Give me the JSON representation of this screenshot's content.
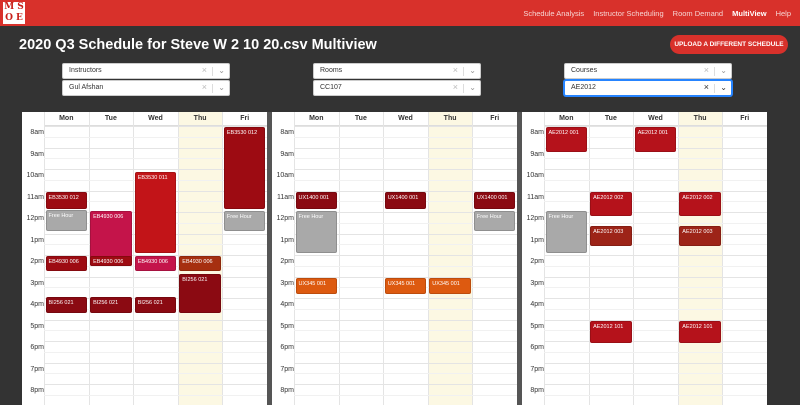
{
  "nav": {
    "schedule_analysis": "Schedule Analysis",
    "instructor_scheduling": "Instructor Scheduling",
    "room_demand": "Room Demand",
    "multiview": "MultiView",
    "help": "Help"
  },
  "logo": {
    "l1": "M S",
    "l2": "O E"
  },
  "page": {
    "title": "2020 Q3 Schedule for Steve W 2 10 20.csv Multiview",
    "upload_label": "UPLOAD A DIFFERENT SCHEDULE"
  },
  "selects": {
    "p1": {
      "type": "Instructors",
      "value": "Gul Afshan"
    },
    "p2": {
      "type": "Rooms",
      "value": "CC107"
    },
    "p3": {
      "type": "Courses",
      "value": "AE2012"
    }
  },
  "days": [
    "Mon",
    "Tue",
    "Wed",
    "Thu",
    "Fri"
  ],
  "times": [
    "8am",
    "9am",
    "10am",
    "11am",
    "12pm",
    "1pm",
    "2pm",
    "3pm",
    "4pm",
    "5pm",
    "6pm",
    "7pm",
    "8pm"
  ],
  "icons": {
    "clear": "×",
    "dropdown": "⌄"
  },
  "colors": {
    "topbar": "#d8312b",
    "thursday": "#fcf8e3",
    "free": "#a9a9a9"
  },
  "panels": [
    {
      "events": [
        {
          "day": 0,
          "start": 11,
          "end": 11.85,
          "label": "EB3530 012",
          "color": "#9d0b12"
        },
        {
          "day": 0,
          "start": 11.85,
          "end": 12.9,
          "label": "Free Hour",
          "color": "#a9a9a9"
        },
        {
          "day": 0,
          "start": 14,
          "end": 14.75,
          "label": "EB4930 006",
          "color": "#9d0b12"
        },
        {
          "day": 0,
          "start": 15.9,
          "end": 16.7,
          "label": "BI256 021",
          "color": "#8b0a12"
        },
        {
          "day": 1,
          "start": 11.9,
          "end": 14.5,
          "label": "EB4930 006",
          "color": "#c4144a"
        },
        {
          "day": 1,
          "start": 14,
          "end": 14.5,
          "label": "EB4930 006",
          "color": "#9d0b12"
        },
        {
          "day": 1,
          "start": 15.9,
          "end": 16.7,
          "label": "BI256 021",
          "color": "#8b0a12"
        },
        {
          "day": 2,
          "start": 10.1,
          "end": 13.9,
          "label": "EB3530 011",
          "color": "#c21418"
        },
        {
          "day": 2,
          "start": 14,
          "end": 14.75,
          "label": "EB4930 006",
          "color": "#c4144a"
        },
        {
          "day": 2,
          "start": 15.9,
          "end": 16.7,
          "label": "BI256 021",
          "color": "#8b0a12"
        },
        {
          "day": 3,
          "start": 14,
          "end": 14.75,
          "label": "EB4930 006",
          "color": "#a62f10"
        },
        {
          "day": 3,
          "start": 14.85,
          "end": 16.7,
          "label": "BI256 021",
          "color": "#8b0a12"
        },
        {
          "day": 4,
          "start": 8,
          "end": 11.85,
          "label": "EB3530 012",
          "color": "#9d0b12"
        },
        {
          "day": 4,
          "start": 11.9,
          "end": 12.9,
          "label": "Free Hour",
          "color": "#a9a9a9"
        }
      ]
    },
    {
      "events": [
        {
          "day": 0,
          "start": 11,
          "end": 11.85,
          "label": "UX1400 001",
          "color": "#8b0a12"
        },
        {
          "day": 0,
          "start": 11.9,
          "end": 13.9,
          "label": "Free Hour",
          "color": "#a9a9a9"
        },
        {
          "day": 0,
          "start": 15,
          "end": 15.8,
          "label": "UX345 001",
          "color": "#dd5a10"
        },
        {
          "day": 2,
          "start": 11,
          "end": 11.85,
          "label": "UX1400 001",
          "color": "#8b0a12"
        },
        {
          "day": 2,
          "start": 15,
          "end": 15.8,
          "label": "UX345 001",
          "color": "#dd5a10"
        },
        {
          "day": 3,
          "start": 15,
          "end": 15.8,
          "label": "UX345 001",
          "color": "#dd5a10"
        },
        {
          "day": 4,
          "start": 11,
          "end": 11.85,
          "label": "UX1400 001",
          "color": "#8b0a12"
        },
        {
          "day": 4,
          "start": 11.9,
          "end": 12.9,
          "label": "Free Hour",
          "color": "#a9a9a9"
        }
      ]
    },
    {
      "events": [
        {
          "day": 0,
          "start": 8,
          "end": 9.2,
          "label": "AE2012 001",
          "color": "#b5121b"
        },
        {
          "day": 0,
          "start": 11.9,
          "end": 13.9,
          "label": "Free Hour",
          "color": "#a9a9a9"
        },
        {
          "day": 1,
          "start": 11,
          "end": 12.2,
          "label": "AE2012 002",
          "color": "#b5121b"
        },
        {
          "day": 1,
          "start": 12.6,
          "end": 13.6,
          "label": "AE2012 003",
          "color": "#9d2418"
        },
        {
          "day": 1,
          "start": 17,
          "end": 18.1,
          "label": "AE2012 101",
          "color": "#b5121b"
        },
        {
          "day": 2,
          "start": 8,
          "end": 9.2,
          "label": "AE2012 001",
          "color": "#b5121b"
        },
        {
          "day": 3,
          "start": 11,
          "end": 12.2,
          "label": "AE2012 002",
          "color": "#b5121b"
        },
        {
          "day": 3,
          "start": 12.6,
          "end": 13.6,
          "label": "AE2012 003",
          "color": "#9d2418"
        },
        {
          "day": 3,
          "start": 17,
          "end": 18.1,
          "label": "AE2012 101",
          "color": "#b5121b"
        }
      ]
    }
  ]
}
